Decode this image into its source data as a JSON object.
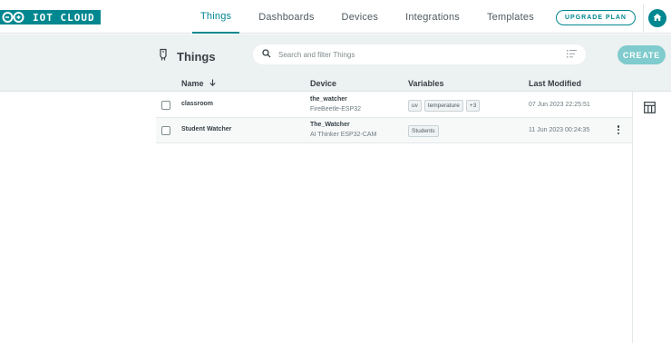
{
  "brand": {
    "logo_text": "IOT CLOUD"
  },
  "nav": {
    "items": [
      {
        "label": "Things",
        "active": true
      },
      {
        "label": "Dashboards",
        "active": false
      },
      {
        "label": "Devices",
        "active": false
      },
      {
        "label": "Integrations",
        "active": false
      },
      {
        "label": "Templates",
        "active": false
      }
    ]
  },
  "header": {
    "upgrade_label": "UPGRADE PLAN",
    "home_icon": "home-icon"
  },
  "page": {
    "title": "Things",
    "title_icon": "thing-icon",
    "search": {
      "placeholder": "Search and filter Things",
      "value": ""
    },
    "create_label": "CREATE"
  },
  "table": {
    "columns": {
      "name": "Name",
      "device": "Device",
      "variables": "Variables",
      "modified": "Last Modified"
    },
    "sort": {
      "column": "name",
      "direction": "desc-arrow"
    },
    "rows": [
      {
        "name": "classroom",
        "device_name": "the_watcher",
        "device_type": "FireBeetle-ESP32",
        "variables": [
          "uv",
          "temperature",
          "+3"
        ],
        "modified": "07 Jun 2023 22:25:51",
        "checked": false
      },
      {
        "name": "Student Watcher",
        "device_name": "The_Watcher",
        "device_type": "AI Thinker ESP32-CAM",
        "variables": [
          "Students"
        ],
        "modified": "11 Jun 2023 00:24:35",
        "checked": false
      }
    ]
  },
  "colors": {
    "accent": "#00878f",
    "create_bg": "#7fcbcd",
    "band_bg": "#ecf1f1"
  }
}
